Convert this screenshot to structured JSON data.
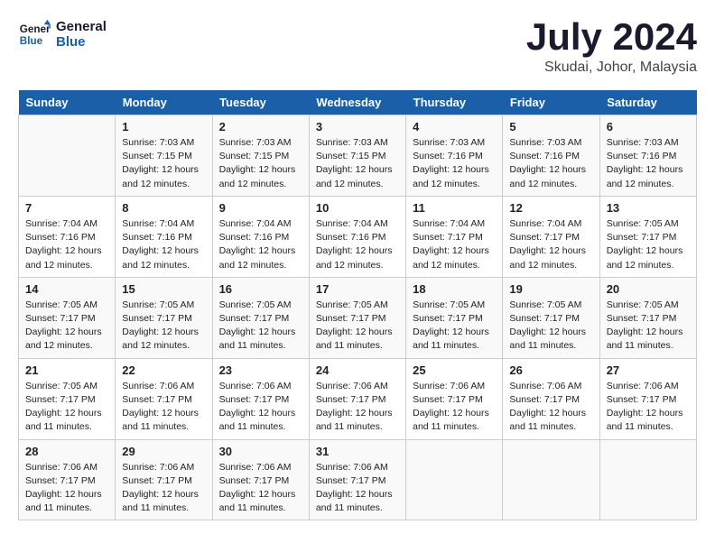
{
  "header": {
    "logo_line1": "General",
    "logo_line2": "Blue",
    "month_year": "July 2024",
    "location": "Skudai, Johor, Malaysia"
  },
  "weekdays": [
    "Sunday",
    "Monday",
    "Tuesday",
    "Wednesday",
    "Thursday",
    "Friday",
    "Saturday"
  ],
  "weeks": [
    [
      {
        "day": "",
        "sunrise": "",
        "sunset": "",
        "daylight": ""
      },
      {
        "day": "1",
        "sunrise": "Sunrise: 7:03 AM",
        "sunset": "Sunset: 7:15 PM",
        "daylight": "Daylight: 12 hours and 12 minutes."
      },
      {
        "day": "2",
        "sunrise": "Sunrise: 7:03 AM",
        "sunset": "Sunset: 7:15 PM",
        "daylight": "Daylight: 12 hours and 12 minutes."
      },
      {
        "day": "3",
        "sunrise": "Sunrise: 7:03 AM",
        "sunset": "Sunset: 7:15 PM",
        "daylight": "Daylight: 12 hours and 12 minutes."
      },
      {
        "day": "4",
        "sunrise": "Sunrise: 7:03 AM",
        "sunset": "Sunset: 7:16 PM",
        "daylight": "Daylight: 12 hours and 12 minutes."
      },
      {
        "day": "5",
        "sunrise": "Sunrise: 7:03 AM",
        "sunset": "Sunset: 7:16 PM",
        "daylight": "Daylight: 12 hours and 12 minutes."
      },
      {
        "day": "6",
        "sunrise": "Sunrise: 7:03 AM",
        "sunset": "Sunset: 7:16 PM",
        "daylight": "Daylight: 12 hours and 12 minutes."
      }
    ],
    [
      {
        "day": "7",
        "sunrise": "Sunrise: 7:04 AM",
        "sunset": "Sunset: 7:16 PM",
        "daylight": "Daylight: 12 hours and 12 minutes."
      },
      {
        "day": "8",
        "sunrise": "Sunrise: 7:04 AM",
        "sunset": "Sunset: 7:16 PM",
        "daylight": "Daylight: 12 hours and 12 minutes."
      },
      {
        "day": "9",
        "sunrise": "Sunrise: 7:04 AM",
        "sunset": "Sunset: 7:16 PM",
        "daylight": "Daylight: 12 hours and 12 minutes."
      },
      {
        "day": "10",
        "sunrise": "Sunrise: 7:04 AM",
        "sunset": "Sunset: 7:16 PM",
        "daylight": "Daylight: 12 hours and 12 minutes."
      },
      {
        "day": "11",
        "sunrise": "Sunrise: 7:04 AM",
        "sunset": "Sunset: 7:17 PM",
        "daylight": "Daylight: 12 hours and 12 minutes."
      },
      {
        "day": "12",
        "sunrise": "Sunrise: 7:04 AM",
        "sunset": "Sunset: 7:17 PM",
        "daylight": "Daylight: 12 hours and 12 minutes."
      },
      {
        "day": "13",
        "sunrise": "Sunrise: 7:05 AM",
        "sunset": "Sunset: 7:17 PM",
        "daylight": "Daylight: 12 hours and 12 minutes."
      }
    ],
    [
      {
        "day": "14",
        "sunrise": "Sunrise: 7:05 AM",
        "sunset": "Sunset: 7:17 PM",
        "daylight": "Daylight: 12 hours and 12 minutes."
      },
      {
        "day": "15",
        "sunrise": "Sunrise: 7:05 AM",
        "sunset": "Sunset: 7:17 PM",
        "daylight": "Daylight: 12 hours and 12 minutes."
      },
      {
        "day": "16",
        "sunrise": "Sunrise: 7:05 AM",
        "sunset": "Sunset: 7:17 PM",
        "daylight": "Daylight: 12 hours and 11 minutes."
      },
      {
        "day": "17",
        "sunrise": "Sunrise: 7:05 AM",
        "sunset": "Sunset: 7:17 PM",
        "daylight": "Daylight: 12 hours and 11 minutes."
      },
      {
        "day": "18",
        "sunrise": "Sunrise: 7:05 AM",
        "sunset": "Sunset: 7:17 PM",
        "daylight": "Daylight: 12 hours and 11 minutes."
      },
      {
        "day": "19",
        "sunrise": "Sunrise: 7:05 AM",
        "sunset": "Sunset: 7:17 PM",
        "daylight": "Daylight: 12 hours and 11 minutes."
      },
      {
        "day": "20",
        "sunrise": "Sunrise: 7:05 AM",
        "sunset": "Sunset: 7:17 PM",
        "daylight": "Daylight: 12 hours and 11 minutes."
      }
    ],
    [
      {
        "day": "21",
        "sunrise": "Sunrise: 7:05 AM",
        "sunset": "Sunset: 7:17 PM",
        "daylight": "Daylight: 12 hours and 11 minutes."
      },
      {
        "day": "22",
        "sunrise": "Sunrise: 7:06 AM",
        "sunset": "Sunset: 7:17 PM",
        "daylight": "Daylight: 12 hours and 11 minutes."
      },
      {
        "day": "23",
        "sunrise": "Sunrise: 7:06 AM",
        "sunset": "Sunset: 7:17 PM",
        "daylight": "Daylight: 12 hours and 11 minutes."
      },
      {
        "day": "24",
        "sunrise": "Sunrise: 7:06 AM",
        "sunset": "Sunset: 7:17 PM",
        "daylight": "Daylight: 12 hours and 11 minutes."
      },
      {
        "day": "25",
        "sunrise": "Sunrise: 7:06 AM",
        "sunset": "Sunset: 7:17 PM",
        "daylight": "Daylight: 12 hours and 11 minutes."
      },
      {
        "day": "26",
        "sunrise": "Sunrise: 7:06 AM",
        "sunset": "Sunset: 7:17 PM",
        "daylight": "Daylight: 12 hours and 11 minutes."
      },
      {
        "day": "27",
        "sunrise": "Sunrise: 7:06 AM",
        "sunset": "Sunset: 7:17 PM",
        "daylight": "Daylight: 12 hours and 11 minutes."
      }
    ],
    [
      {
        "day": "28",
        "sunrise": "Sunrise: 7:06 AM",
        "sunset": "Sunset: 7:17 PM",
        "daylight": "Daylight: 12 hours and 11 minutes."
      },
      {
        "day": "29",
        "sunrise": "Sunrise: 7:06 AM",
        "sunset": "Sunset: 7:17 PM",
        "daylight": "Daylight: 12 hours and 11 minutes."
      },
      {
        "day": "30",
        "sunrise": "Sunrise: 7:06 AM",
        "sunset": "Sunset: 7:17 PM",
        "daylight": "Daylight: 12 hours and 11 minutes."
      },
      {
        "day": "31",
        "sunrise": "Sunrise: 7:06 AM",
        "sunset": "Sunset: 7:17 PM",
        "daylight": "Daylight: 12 hours and 11 minutes."
      },
      {
        "day": "",
        "sunrise": "",
        "sunset": "",
        "daylight": ""
      },
      {
        "day": "",
        "sunrise": "",
        "sunset": "",
        "daylight": ""
      },
      {
        "day": "",
        "sunrise": "",
        "sunset": "",
        "daylight": ""
      }
    ]
  ]
}
